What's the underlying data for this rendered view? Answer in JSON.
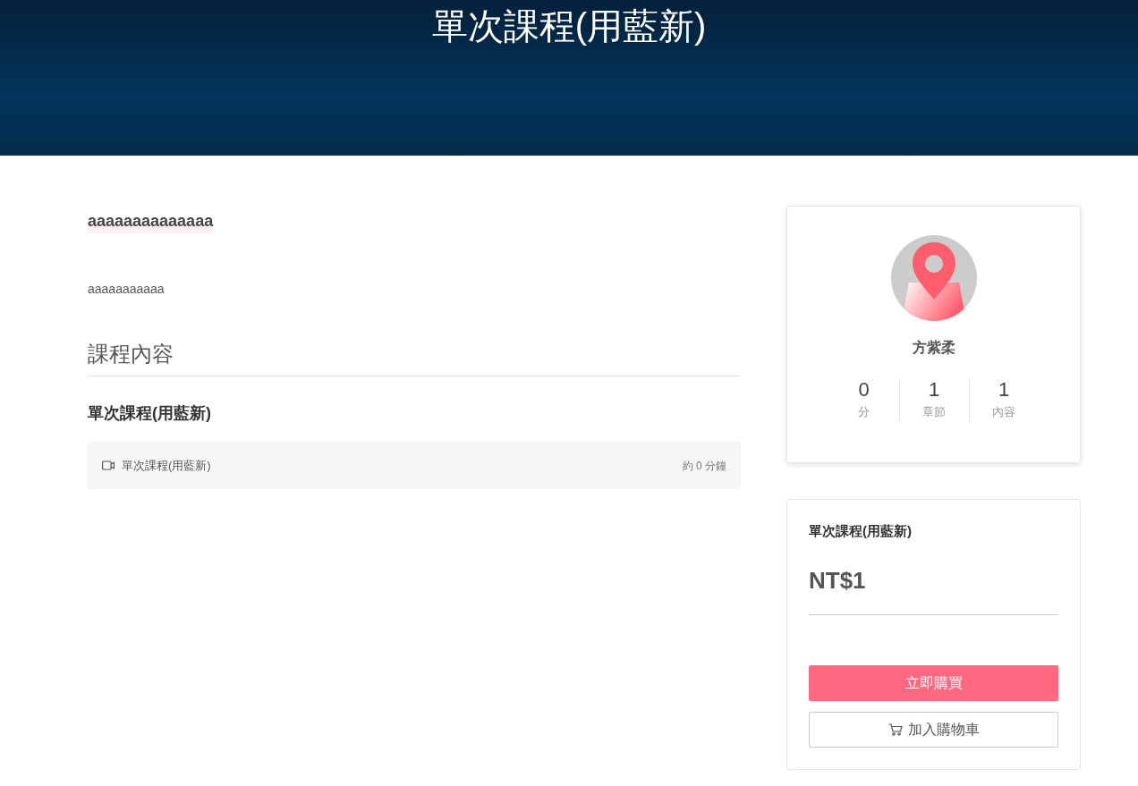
{
  "banner": {
    "title": "單次課程(用藍新)"
  },
  "course": {
    "heading": "aaaaaaaaaaaaaa",
    "description": "aaaaaaaaaaa",
    "section_title": "課程內容",
    "chapters": [
      {
        "title": "單次課程(用藍新)",
        "lessons": [
          {
            "kind": "video",
            "title": "單次課程(用藍新)",
            "duration": "約 0 分鐘"
          }
        ]
      }
    ]
  },
  "instructor": {
    "name": "方紫柔",
    "stats": [
      {
        "value": "0",
        "label": "分"
      },
      {
        "value": "1",
        "label": "章節"
      },
      {
        "value": "1",
        "label": "內容"
      }
    ]
  },
  "purchase": {
    "title": "單次課程(用藍新)",
    "price": "NT$1",
    "buy_button": "立即購買",
    "cart_button": "加入購物車"
  }
}
